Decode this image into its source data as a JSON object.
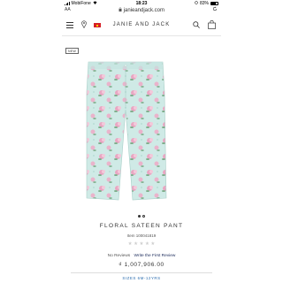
{
  "status_bar": {
    "carrier": "MobiFone",
    "time": "18:23",
    "battery": "83%"
  },
  "browser": {
    "aa_label": "AA",
    "url": "janieandjack.com"
  },
  "header": {
    "brand": "JANIE AND JACK"
  },
  "product": {
    "badge": "NEW",
    "title": "FLORAL SATEEN PANT",
    "item_number": "Item 100041819",
    "rating": 0,
    "rating_max": 5,
    "reviews_label": "No Reviews",
    "write_review_label": "Write the First Review",
    "price": "₫ 1,007,906.00",
    "sizes": "SIZES 6M-12YRS",
    "image_count": 2,
    "active_image": 1
  },
  "icons": {
    "menu": "menu-icon",
    "store": "location-pin-icon",
    "flag": "vietnam-flag-icon",
    "search": "search-icon",
    "bag": "shopping-bag-icon"
  },
  "colors": {
    "fabric": "#cfeae6",
    "flower_pink": "#e9a6c2",
    "flower_leaf": "#7fae8c",
    "link": "#2f6fb0"
  }
}
